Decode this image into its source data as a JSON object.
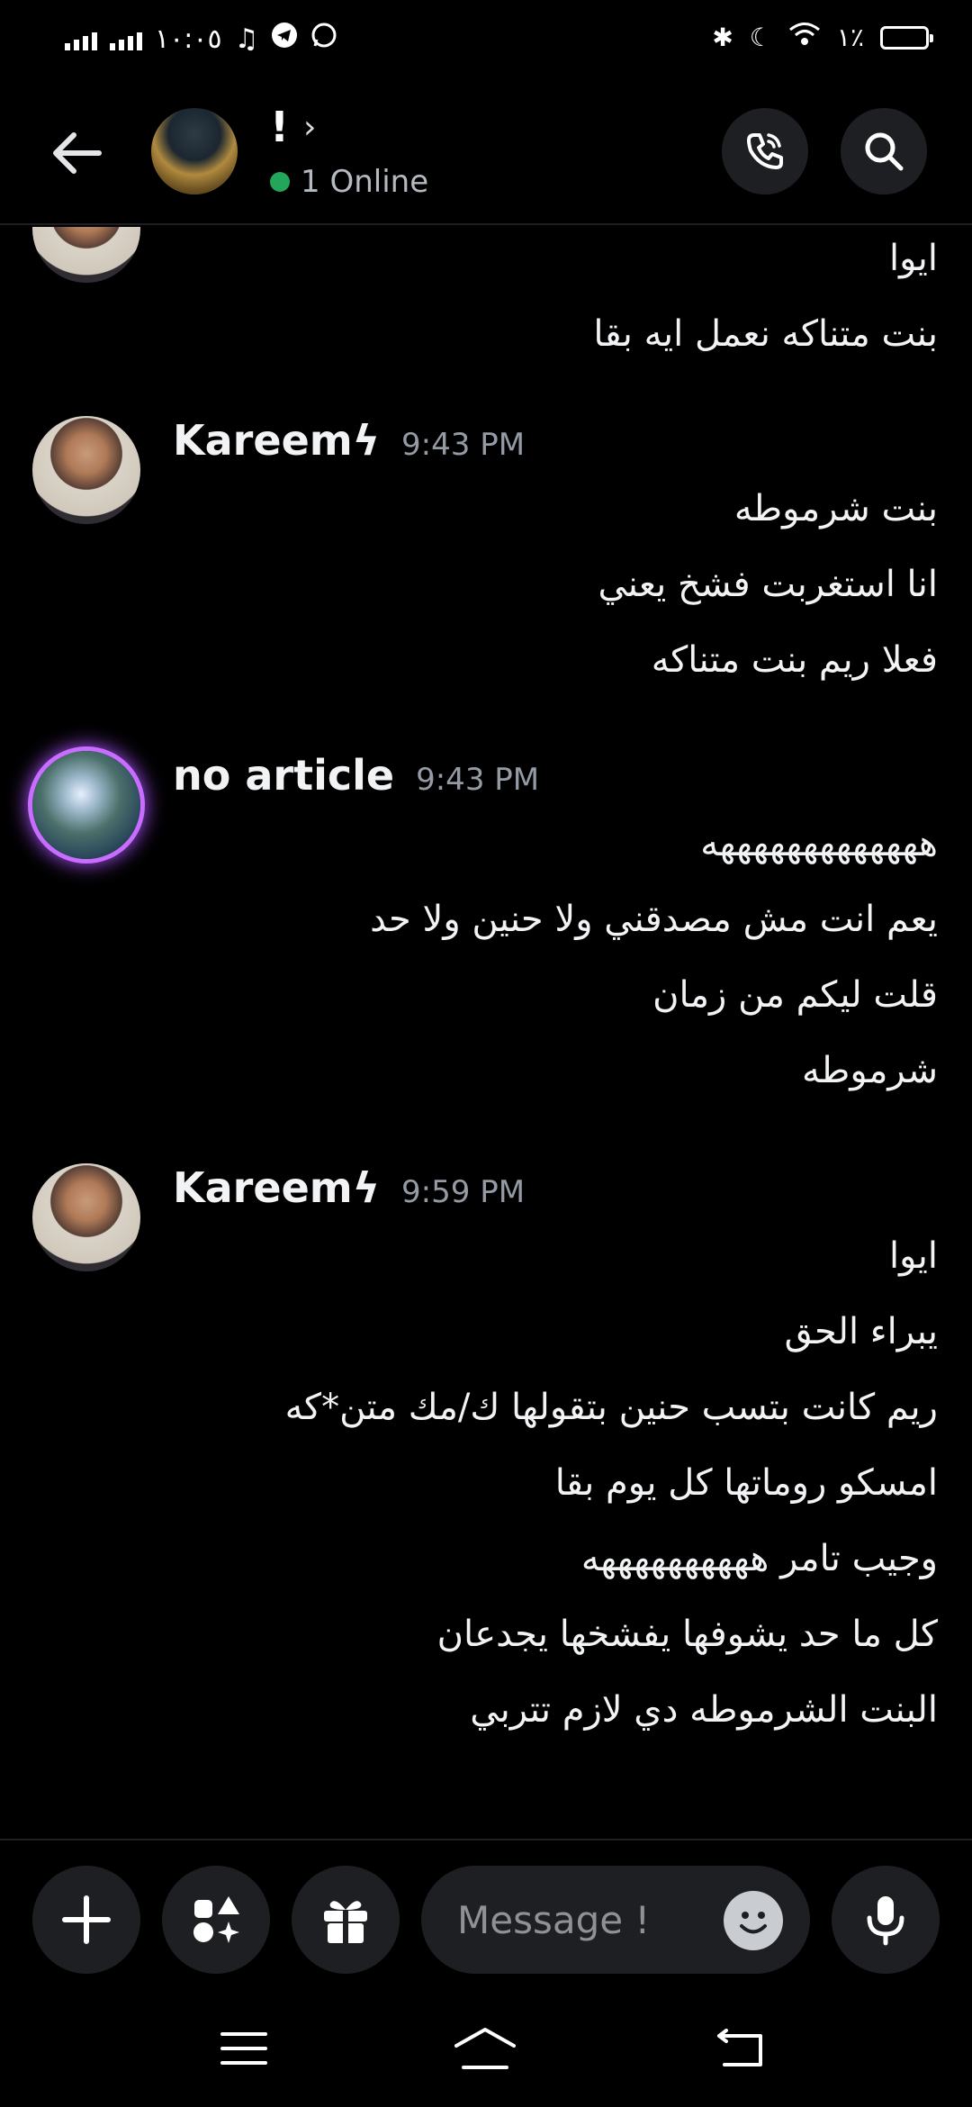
{
  "status_bar": {
    "time": "١٠:٠٥",
    "battery": "١٪"
  },
  "header": {
    "title": "!",
    "status": "1 Online"
  },
  "messages": [
    {
      "lines": [
        "ايوا",
        "بنت متناكه نعمل ايه بقا"
      ]
    },
    {
      "author": "Kareemϟ",
      "time": "9:43 PM",
      "lines": [
        "بنت شرموطه",
        "انا استغربت فشخ يعني",
        "فعلا ريم بنت متناكه"
      ]
    },
    {
      "author": "no article",
      "time": "9:43 PM",
      "lines": [
        "هههههههههههههه",
        "يعم انت مش مصدقني ولا حنين ولا حد",
        "قلت ليكم من زمان",
        "شرموطه"
      ]
    },
    {
      "author": "Kareemϟ",
      "time": "9:59 PM",
      "lines": [
        "ايوا",
        "يبراء الحق",
        "ريم كانت بتسب حنين بتقولها ك/مك متن*كه",
        "امسكو روماتها كل يوم بقا",
        "وجيب تامر ههههههههههه",
        "كل ما حد يشوفها يفشخها يجدعان",
        "البنت الشرموطه دي لازم تتربي"
      ]
    }
  ],
  "composer": {
    "placeholder": "Message !"
  },
  "colors": {
    "online": "#23a55a",
    "background": "#000000",
    "surface": "#1e1f22",
    "timestamp": "#949ba4",
    "avatar_ring": "#c86dff"
  }
}
